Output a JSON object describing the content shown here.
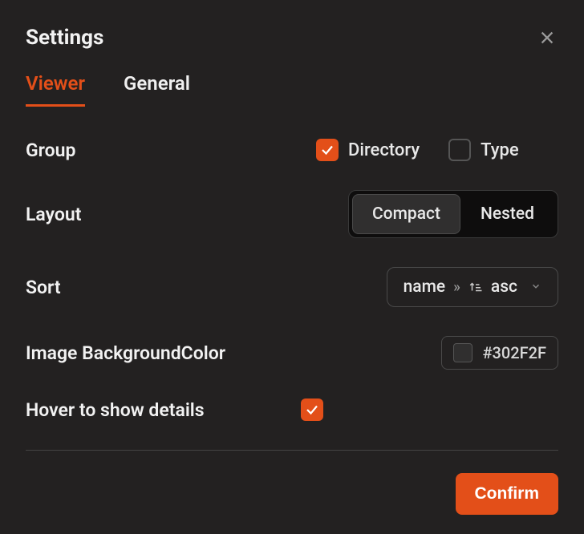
{
  "title": "Settings",
  "tabs": {
    "viewer": "Viewer",
    "general": "General",
    "active": "viewer"
  },
  "group": {
    "label": "Group",
    "directory": {
      "label": "Directory",
      "checked": true
    },
    "type": {
      "label": "Type",
      "checked": false
    }
  },
  "layout": {
    "label": "Layout",
    "options": {
      "compact": "Compact",
      "nested": "Nested"
    },
    "selected": "compact"
  },
  "sort": {
    "label": "Sort",
    "field": "name",
    "direction": "asc"
  },
  "bgcolor": {
    "label": "Image BackgroundColor",
    "value": "#302F2F"
  },
  "hover": {
    "label": "Hover to show details",
    "checked": true
  },
  "confirm": "Confirm"
}
